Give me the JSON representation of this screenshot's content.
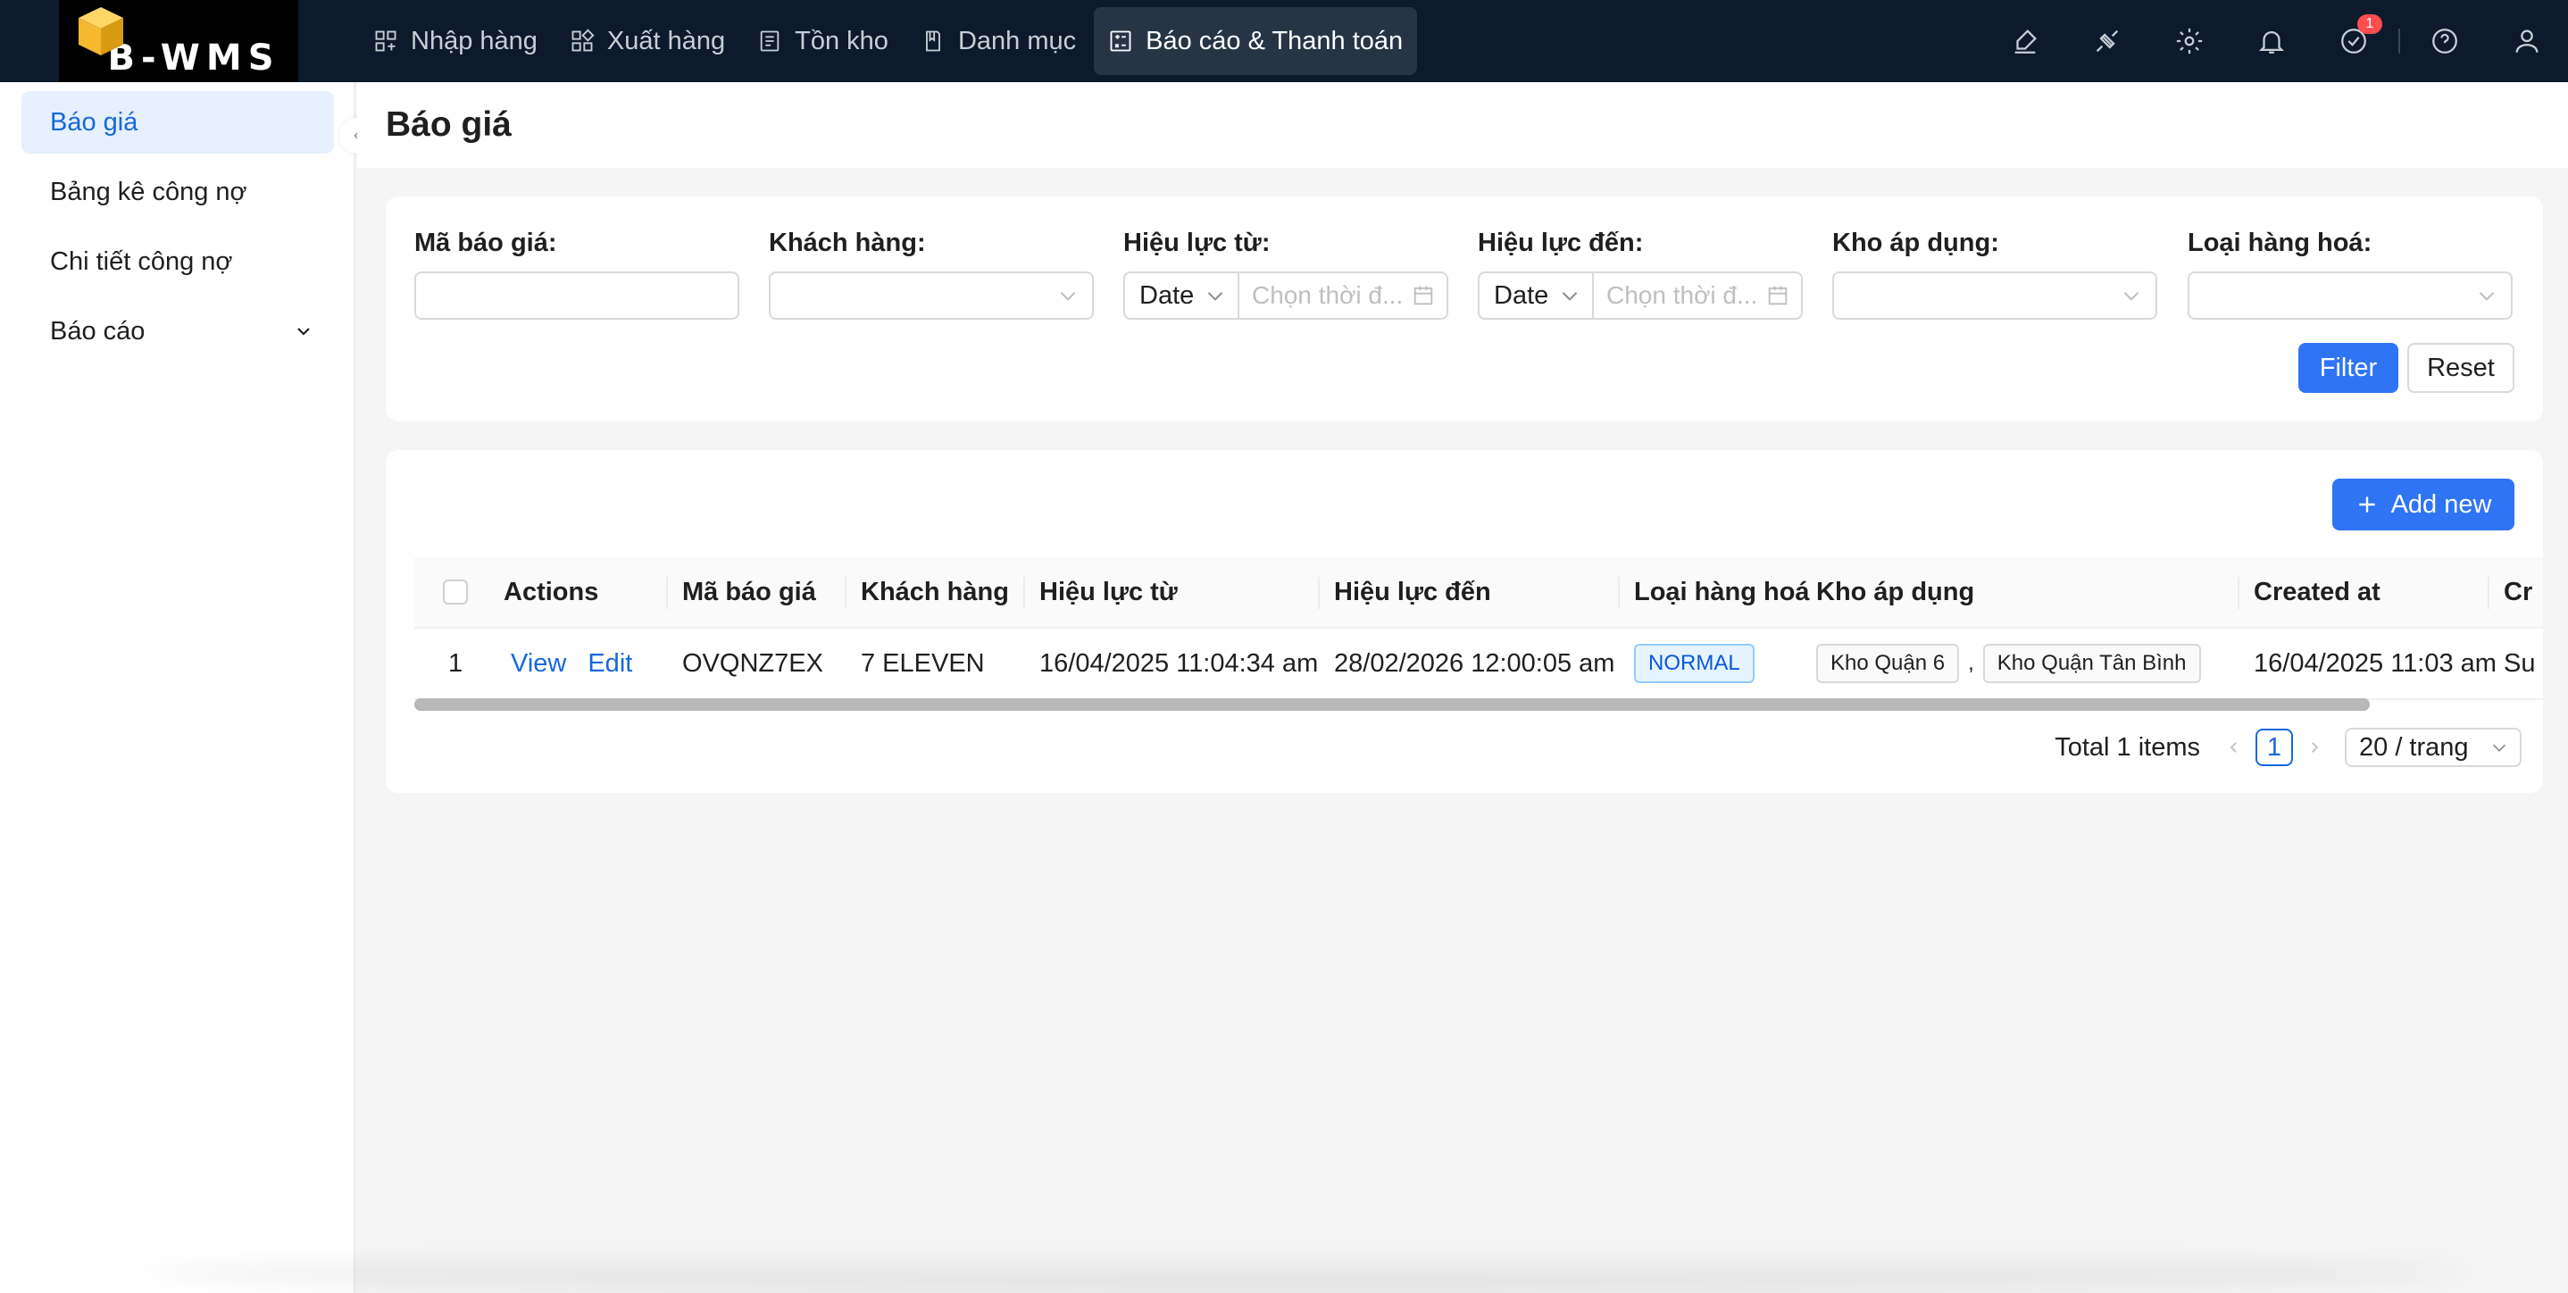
{
  "app": {
    "logo_text": "B-WMS"
  },
  "topnav": {
    "items": [
      {
        "label": "Nhập hàng",
        "icon": "import-icon"
      },
      {
        "label": "Xuất hàng",
        "icon": "export-icon"
      },
      {
        "label": "Tồn kho",
        "icon": "inventory-icon"
      },
      {
        "label": "Danh mục",
        "icon": "catalog-icon"
      },
      {
        "label": "Báo cáo & Thanh toán",
        "icon": "report-icon",
        "active": true
      }
    ],
    "notification_badge": "1"
  },
  "sidebar": {
    "items": [
      {
        "label": "Báo giá",
        "active": true
      },
      {
        "label": "Bảng kê công nợ"
      },
      {
        "label": "Chi tiết công nợ"
      },
      {
        "label": "Báo cáo",
        "expandable": true
      }
    ]
  },
  "page": {
    "title": "Báo giá"
  },
  "filters": {
    "quote_code": {
      "label": "Mã báo giá",
      "value": ""
    },
    "customer": {
      "label": "Khách hàng",
      "value": ""
    },
    "valid_from": {
      "label": "Hiệu lực từ",
      "type": "Date",
      "placeholder": "Chọn thời đ..."
    },
    "valid_to": {
      "label": "Hiệu lực đến",
      "type": "Date",
      "placeholder": "Chọn thời đ..."
    },
    "warehouse": {
      "label": "Kho áp dụng",
      "value": ""
    },
    "goods_type": {
      "label": "Loại hàng hoá",
      "value": ""
    },
    "filter_label": "Filter",
    "reset_label": "Reset"
  },
  "table": {
    "add_label": "Add new",
    "columns": [
      "Actions",
      "Mã báo giá",
      "Khách hàng",
      "Hiệu lực từ",
      "Hiệu lực đến",
      "Loại hàng hoá",
      "Kho áp dụng",
      "Created at",
      "Cr"
    ],
    "rows": [
      {
        "index": "1",
        "view_label": "View",
        "edit_label": "Edit",
        "code": "OVQNZ7EX",
        "customer": "7 ELEVEN",
        "valid_from": "16/04/2025 11:04:34 am",
        "valid_to": "28/02/2026 12:00:05 am",
        "goods_type": "NORMAL",
        "warehouses": [
          "Kho Quận 6",
          "Kho Quận Tân Bình"
        ],
        "warehouse_sep": ",",
        "created_at": "16/04/2025 11:03 am",
        "created_by": "Su"
      }
    ],
    "scroll_position": 0.0
  },
  "pagination": {
    "total_text": "Total 1 items",
    "current_page": "1",
    "page_size": "20 / trang"
  },
  "colors": {
    "nav_bg": "#0c1a2b",
    "primary": "#2f74f5",
    "link": "#1668dc"
  }
}
